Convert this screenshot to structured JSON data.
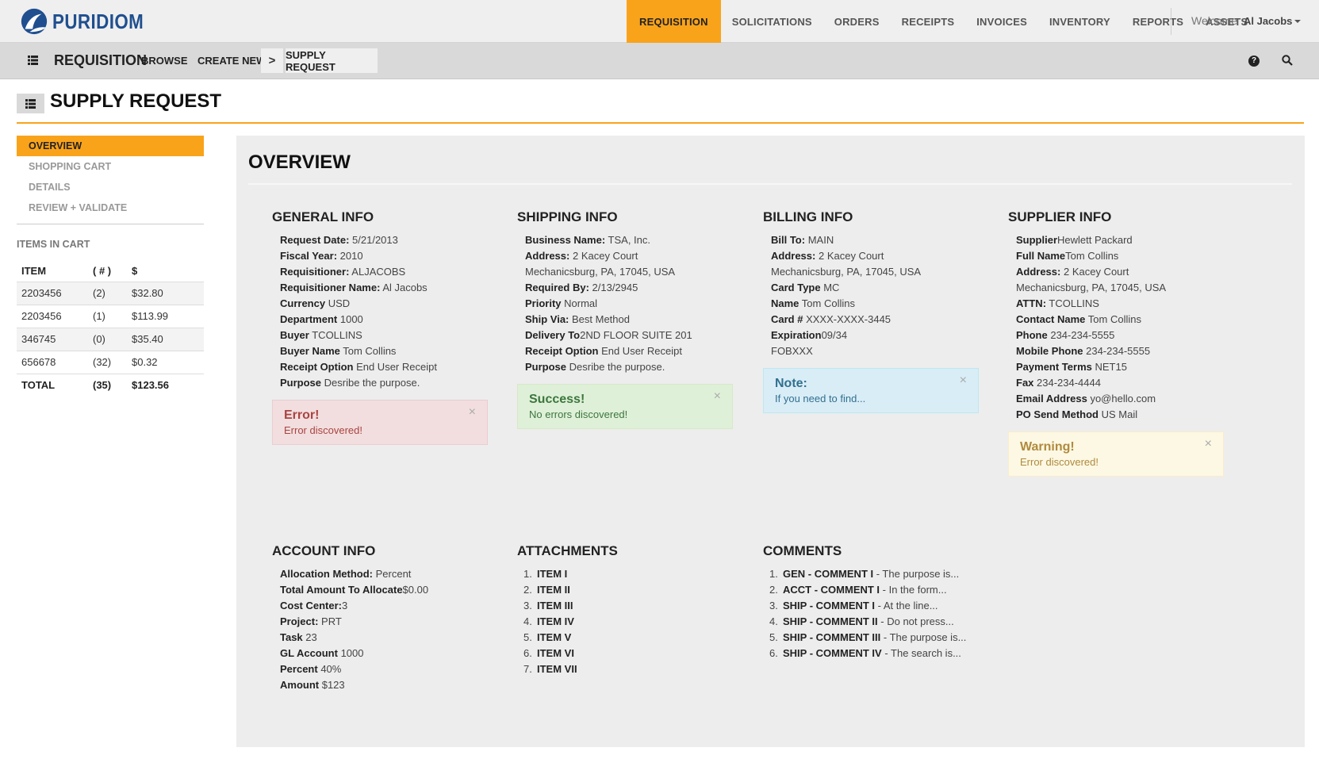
{
  "brand": {
    "name": "PURIDIOM"
  },
  "main_menu": [
    {
      "label": "REQUISITION",
      "active": true
    },
    {
      "label": "SOLICITATIONS",
      "active": false
    },
    {
      "label": "ORDERS",
      "active": false
    },
    {
      "label": "RECEIPTS",
      "active": false
    },
    {
      "label": "INVOICES",
      "active": false
    },
    {
      "label": "INVENTORY",
      "active": false
    },
    {
      "label": "REPORTS",
      "active": false
    },
    {
      "label": "ASSETS",
      "active": false
    }
  ],
  "user": {
    "welcome": "Welcome",
    "name": "Al Jacobs"
  },
  "subnav": {
    "title": "REQUISITION",
    "browse": "BROWSE",
    "create_new": "CREATE NEW",
    "chevron": ">",
    "current": "SUPPLY REQUEST",
    "help_icon": "question-circle-icon",
    "search_icon": "search-icon"
  },
  "page_title": "SUPPLY REQUEST",
  "sidebar": {
    "items": [
      {
        "label": "OVERVIEW",
        "active": true
      },
      {
        "label": "SHOPPING CART",
        "active": false
      },
      {
        "label": "DETAILS",
        "active": false
      },
      {
        "label": "REVIEW + VALIDATE",
        "active": false
      }
    ],
    "cart_title": "ITEMS IN CART",
    "cart_headers": [
      "ITEM",
      "( # )",
      "$"
    ],
    "cart_rows": [
      [
        "2203456",
        "(2)",
        "$32.80"
      ],
      [
        "2203456",
        "(1)",
        "$113.99"
      ],
      [
        "346745",
        "(0)",
        "$35.40"
      ],
      [
        "656678",
        "(32)",
        "$0.32"
      ]
    ],
    "cart_total": [
      "TOTAL",
      "(35)",
      "$123.56"
    ]
  },
  "overview": {
    "title": "OVERVIEW",
    "general": {
      "title": "GENERAL INFO",
      "rows": [
        {
          "label": "Request Date:",
          "value": " 5/21/2013"
        },
        {
          "label": "Fiscal Year:",
          "value": " 2010"
        },
        {
          "label": "Requisitioner:",
          "value": " ALJACOBS"
        },
        {
          "label": "Requisitioner Name:",
          "value": " Al Jacobs"
        },
        {
          "label": "Currency",
          "value": " USD"
        },
        {
          "label": "Department",
          "value": " 1000"
        },
        {
          "label": "Buyer",
          "value": " TCOLLINS"
        },
        {
          "label": "Buyer Name",
          "value": " Tom Collins"
        },
        {
          "label": "Receipt Option",
          "value": " End User Receipt"
        },
        {
          "label": "Purpose",
          "value": " Desribe the purpose."
        }
      ],
      "alert": {
        "heading": "Error!",
        "body": "Error discovered!",
        "close": "×"
      }
    },
    "shipping": {
      "title": "SHIPPING INFO",
      "rows": [
        {
          "label": "Business Name:",
          "value": " TSA, Inc."
        },
        {
          "label": "Address:",
          "value": " 2 Kacey Court"
        },
        {
          "label": "",
          "value": "Mechanicsburg, PA, 17045, USA"
        },
        {
          "label": "Required By:",
          "value": " 2/13/2945"
        },
        {
          "label": "Priority",
          "value": " Normal"
        },
        {
          "label": "Ship Via:",
          "value": " Best Method"
        },
        {
          "label": "Delivery To",
          "value": "2ND FLOOR SUITE 201"
        },
        {
          "label": "Receipt Option",
          "value": " End User Receipt"
        },
        {
          "label": "Purpose",
          "value": " Desribe the purpose."
        }
      ],
      "alert": {
        "heading": "Success!",
        "body": "No errors discovered!",
        "close": "×"
      }
    },
    "billing": {
      "title": "BILLING INFO",
      "rows": [
        {
          "label": "Bill To:",
          "value": " MAIN"
        },
        {
          "label": "Address:",
          "value": " 2 Kacey Court"
        },
        {
          "label": "",
          "value": "Mechanicsburg, PA, 17045, USA"
        },
        {
          "label": "Card Type",
          "value": " MC"
        },
        {
          "label": "Name",
          "value": " Tom Collins"
        },
        {
          "label": "Card #",
          "value": " XXXX-XXXX-3445"
        },
        {
          "label": "Expiration",
          "value": "09/34"
        },
        {
          "label": "",
          "value": "FOBXXX"
        }
      ],
      "alert": {
        "heading": "Note:",
        "body": "If you need to find...",
        "close": "×"
      }
    },
    "supplier": {
      "title": "SUPPLIER INFO",
      "rows": [
        {
          "label": "Supplier",
          "value": "Hewlett Packard"
        },
        {
          "label": "Full Name",
          "value": "Tom Collins"
        },
        {
          "label": "Address:",
          "value": " 2 Kacey Court"
        },
        {
          "label": "",
          "value": "Mechanicsburg, PA, 17045, USA"
        },
        {
          "label": "ATTN:",
          "value": " TCOLLINS"
        },
        {
          "label": "Contact Name",
          "value": " Tom Collins"
        },
        {
          "label": "Phone",
          "value": " 234-234-5555"
        },
        {
          "label": "Mobile Phone",
          "value": " 234-234-5555"
        },
        {
          "label": "Payment Terms",
          "value": " NET15"
        },
        {
          "label": "Fax",
          "value": " 234-234-4444"
        },
        {
          "label": "Email Address",
          "value": " yo@hello.com"
        },
        {
          "label": "PO Send Method",
          "value": " US Mail"
        }
      ],
      "alert": {
        "heading": "Warning!",
        "body": "Error discovered!",
        "close": "×"
      }
    },
    "account": {
      "title": "ACCOUNT INFO",
      "rows": [
        {
          "label": "Allocation Method:",
          "value": " Percent"
        },
        {
          "label": "Total Amount To Allocate",
          "value": "$0.00"
        },
        {
          "label": "Cost Center:",
          "value": "3"
        },
        {
          "label": "Project:",
          "value": " PRT"
        },
        {
          "label": "Task",
          "value": " 23"
        },
        {
          "label": "GL Account",
          "value": " 1000"
        },
        {
          "label": "Percent",
          "value": " 40%"
        },
        {
          "label": "Amount",
          "value": " $123"
        }
      ]
    },
    "attachments": {
      "title": "ATTACHMENTS",
      "items": [
        {
          "num": "1.",
          "label": "ITEM I",
          "text": ""
        },
        {
          "num": "2.",
          "label": "ITEM II",
          "text": ""
        },
        {
          "num": "3.",
          "label": "ITEM III",
          "text": ""
        },
        {
          "num": "4.",
          "label": "ITEM IV",
          "text": ""
        },
        {
          "num": "5.",
          "label": "ITEM V",
          "text": ""
        },
        {
          "num": "6.",
          "label": "ITEM VI",
          "text": ""
        },
        {
          "num": "7.",
          "label": "ITEM VII",
          "text": ""
        }
      ]
    },
    "comments": {
      "title": "COMMENTS",
      "items": [
        {
          "num": "1.",
          "label": "GEN - COMMENT I",
          "text": " - The purpose is..."
        },
        {
          "num": "2.",
          "label": "ACCT - COMMENT I",
          "text": " - In the form..."
        },
        {
          "num": "3.",
          "label": "SHIP - COMMENT I",
          "text": " - At the line..."
        },
        {
          "num": "4.",
          "label": "SHIP - COMMENT II",
          "text": " - Do not press..."
        },
        {
          "num": "5.",
          "label": "SHIP - COMMENT III",
          "text": " - The purpose is..."
        },
        {
          "num": "6.",
          "label": "SHIP - COMMENT IV",
          "text": " - The search is..."
        }
      ]
    }
  },
  "colors": {
    "accent": "#f9a31b",
    "brand": "#1f4f8f",
    "error": "#a94442",
    "success": "#3c763d",
    "info": "#31708f",
    "warning": "#b08a3e"
  }
}
